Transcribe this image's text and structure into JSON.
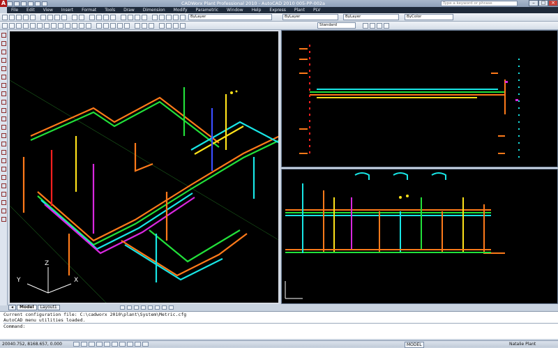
{
  "window": {
    "title": "CADWorx Plant Professional 2010 - AutoCAD 2010    005-PP-002a",
    "search_placeholder": "Type a keyword or phrase",
    "app_icon": "A"
  },
  "menu": [
    "File",
    "Edit",
    "View",
    "Insert",
    "Format",
    "Tools",
    "Draw",
    "Dimension",
    "Modify",
    "Parametric",
    "Window",
    "Help",
    "Express",
    "Plant",
    "PLV"
  ],
  "toolbar": {
    "layer_combo": "ByLayer",
    "linetype_combo": "ByLayer",
    "lineweight_combo": "ByLayer",
    "color_combo": "ByColor",
    "style_combo": "Standard"
  },
  "tabs": {
    "model": "Model",
    "layout": "Layout1"
  },
  "command_history": [
    "Current configuration file: C:\\cadworx 2010\\plant\\System\\Metric.cfg",
    "AutoCAD menu utilities loaded.",
    "Command:"
  ],
  "status": {
    "coords": "20040.752, 8168.657, 0.000",
    "model": "MODEL",
    "user": "Natalie Plant"
  },
  "viewport_axes": {
    "x": "X",
    "y": "Y",
    "z": "Z"
  },
  "colors": {
    "accent": "#c01818",
    "viewport_bg": "#000000",
    "pipe_orange": "#ff7a1a",
    "pipe_green": "#22e03a",
    "pipe_cyan": "#18e6e6",
    "pipe_magenta": "#d928e0",
    "pipe_yellow": "#ffe21a",
    "pipe_blue": "#3a4cff",
    "pipe_red": "#ff2020"
  }
}
